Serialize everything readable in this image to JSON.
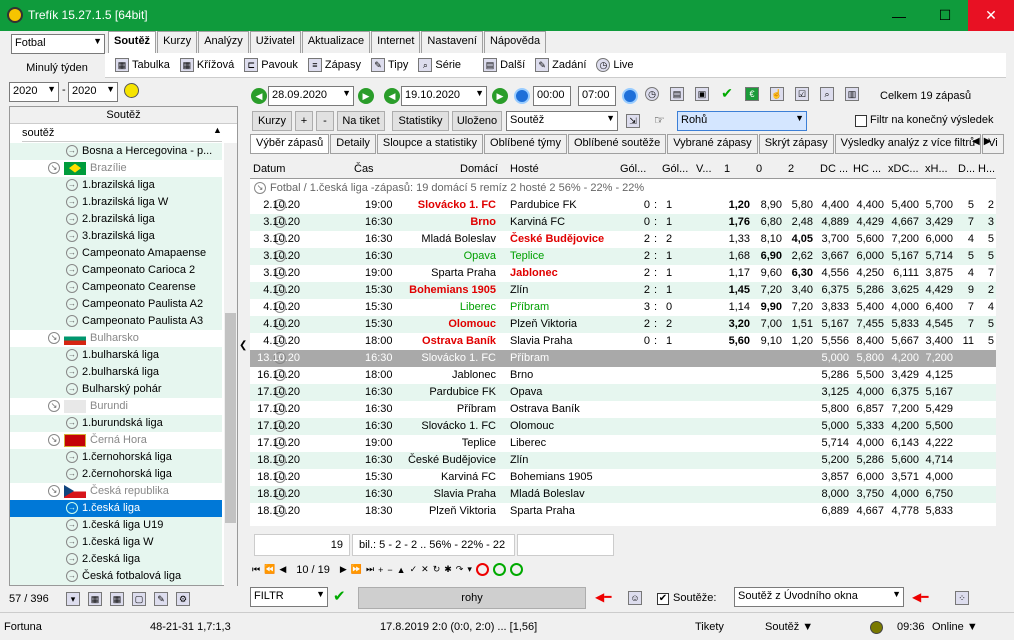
{
  "window": {
    "title": "Trefík 15.27.1.5 [64bit]",
    "min": "—",
    "max": "☐",
    "close": "✕"
  },
  "sport_select": "Fotbal",
  "period_label": "Minulý týden",
  "year_from": "2020",
  "year_to": "2020",
  "year_sep": "-",
  "menu": [
    "Soutěž",
    "Kurzy",
    "Analýzy",
    "Uživatel",
    "Aktualizace",
    "Internet",
    "Nastavení",
    "Nápověda"
  ],
  "toolbar": [
    "Tabulka",
    "Křížová",
    "Pavouk",
    "Zápasy",
    "Tipy",
    "Série",
    "Další",
    "Zadání",
    "Live"
  ],
  "left": {
    "header": "Soutěž",
    "filter": "soutěž",
    "count": "57 / 396",
    "rows": [
      {
        "t": "Bosna a Hercegovina - p...",
        "k": "lg"
      },
      {
        "t": "Brazílie",
        "k": "country",
        "flag": "br"
      },
      {
        "t": "1.brazilská liga",
        "k": "lg"
      },
      {
        "t": "1.brazilská liga W",
        "k": "lg"
      },
      {
        "t": "2.brazilská liga",
        "k": "lg"
      },
      {
        "t": "3.brazilská liga",
        "k": "lg"
      },
      {
        "t": "Campeonato Amapaense",
        "k": "lg"
      },
      {
        "t": "Campeonato Carioca 2",
        "k": "lg"
      },
      {
        "t": "Campeonato Cearense",
        "k": "lg"
      },
      {
        "t": "Campeonato Paulista A2",
        "k": "lg"
      },
      {
        "t": "Campeonato Paulista A3",
        "k": "lg"
      },
      {
        "t": "Bulharsko",
        "k": "country",
        "flag": "bg"
      },
      {
        "t": "1.bulharská liga",
        "k": "lg"
      },
      {
        "t": "2.bulharská liga",
        "k": "lg"
      },
      {
        "t": "Bulharský pohár",
        "k": "lg"
      },
      {
        "t": "Burundi",
        "k": "country",
        "flag": "bu"
      },
      {
        "t": "1.burundská liga",
        "k": "lg"
      },
      {
        "t": "Černá Hora",
        "k": "country",
        "flag": "me"
      },
      {
        "t": "1.černohorská liga",
        "k": "lg"
      },
      {
        "t": "2.černohorská liga",
        "k": "lg"
      },
      {
        "t": "Česká republika",
        "k": "country",
        "flag": "cz"
      },
      {
        "t": "1.česká liga",
        "k": "sel"
      },
      {
        "t": "1.česká liga U19",
        "k": "lg"
      },
      {
        "t": "1.česká liga W",
        "k": "lg"
      },
      {
        "t": "2.česká liga",
        "k": "lg"
      },
      {
        "t": "Česká fotbalová liga",
        "k": "lg"
      }
    ]
  },
  "date_from": "28.09.2020",
  "date_to": "19.10.2020",
  "time_from": "00:00",
  "time_to": "07:00",
  "total_label": "Celkem 19 zápasů",
  "buttons": {
    "kurzy": "Kurzy",
    "plus": "+",
    "minus": "-",
    "na_tiket": "Na tiket",
    "statistiky": "Statistiky",
    "ulozeno": "Uloženo"
  },
  "souteze_select": "Soutěž",
  "rohu_select": "Rohů",
  "filtr_label": "Filtr na konečný výsledek",
  "tabs2": [
    "Výběr zápasů",
    "Detaily",
    "Sloupce a statistiky",
    "Oblíbené týmy",
    "Oblíbené soutěže",
    "Vybrané zápasy",
    "Skrýt zápasy",
    "Výsledky analýz z více filtrů",
    "Vi"
  ],
  "cols": [
    "Datum",
    "Čas",
    "Domácí",
    "Hosté",
    "Gól...",
    "Gól...",
    "V...",
    "1",
    "0",
    "2",
    "DC ...",
    "HC ...",
    "xDC...",
    "xH...",
    "D...",
    "H..."
  ],
  "group": "Fotbal / 1.česká liga -zápasů: 19  domácí 5  remíz 2  hosté 2      56% - 22% - 22%",
  "rows": [
    {
      "d": "2.10.20",
      "t": "19:00",
      "h": "Slovácko 1. FC",
      "a": "Pardubice FK",
      "g1": "0",
      "g2": "1",
      "o1": "1,20",
      "o0": "8,90",
      "o2": "5,80",
      "dc": "4,400",
      "hc": "4,400",
      "xdc": "5,400",
      "xh": "5,700",
      "dd": "5",
      "hh": "2",
      "hs": "r",
      "as": "",
      "bo": "1"
    },
    {
      "d": "3.10.20",
      "t": "16:30",
      "h": "Brno",
      "a": "Karviná FC",
      "g1": "0",
      "g2": "1",
      "o1": "1,76",
      "o0": "6,80",
      "o2": "2,48",
      "dc": "4,889",
      "hc": "4,429",
      "xdc": "4,667",
      "xh": "3,429",
      "dd": "7",
      "hh": "3",
      "hs": "r",
      "as": "",
      "bo": "1"
    },
    {
      "d": "3.10.20",
      "t": "16:30",
      "h": "Mladá Boleslav",
      "a": "České Budějovice",
      "g1": "2",
      "g2": "2",
      "o1": "1,33",
      "o0": "8,10",
      "o2": "4,05",
      "dc": "3,700",
      "hc": "5,600",
      "xdc": "7,200",
      "xh": "6,000",
      "dd": "4",
      "hh": "5",
      "hs": "",
      "as": "r",
      "bo": "2"
    },
    {
      "d": "3.10.20",
      "t": "16:30",
      "h": "Opava",
      "a": "Teplice",
      "g1": "2",
      "g2": "1",
      "o1": "1,68",
      "o0": "6,90",
      "o2": "2,62",
      "dc": "3,667",
      "hc": "6,000",
      "xdc": "5,167",
      "xh": "5,714",
      "dd": "5",
      "hh": "5",
      "hs": "g",
      "as": "g",
      "bo": "0"
    },
    {
      "d": "3.10.20",
      "t": "19:00",
      "h": "Sparta Praha",
      "a": "Jablonec",
      "g1": "2",
      "g2": "1",
      "o1": "1,17",
      "o0": "9,60",
      "o2": "6,30",
      "dc": "4,556",
      "hc": "4,250",
      "xdc": "6,111",
      "xh": "3,875",
      "dd": "4",
      "hh": "7",
      "hs": "",
      "as": "r",
      "bo": "2"
    },
    {
      "d": "4.10.20",
      "t": "15:30",
      "h": "Bohemians 1905",
      "a": "Zlín",
      "g1": "2",
      "g2": "1",
      "o1": "1,45",
      "o0": "7,20",
      "o2": "3,40",
      "dc": "6,375",
      "hc": "5,286",
      "xdc": "3,625",
      "xh": "4,429",
      "dd": "9",
      "hh": "2",
      "hs": "r",
      "as": "",
      "bo": "1"
    },
    {
      "d": "4.10.20",
      "t": "15:30",
      "h": "Liberec",
      "a": "Příbram",
      "g1": "3",
      "g2": "0",
      "o1": "1,14",
      "o0": "9,90",
      "o2": "7,20",
      "dc": "3,833",
      "hc": "5,400",
      "xdc": "4,000",
      "xh": "6,400",
      "dd": "7",
      "hh": "4",
      "hs": "g",
      "as": "g",
      "bo": "0"
    },
    {
      "d": "4.10.20",
      "t": "15:30",
      "h": "Olomouc",
      "a": "Plzeň Viktoria",
      "g1": "2",
      "g2": "2",
      "o1": "3,20",
      "o0": "7,00",
      "o2": "1,51",
      "dc": "5,167",
      "hc": "7,455",
      "xdc": "5,833",
      "xh": "4,545",
      "dd": "7",
      "hh": "5",
      "hs": "r",
      "as": "",
      "bo": "1"
    },
    {
      "d": "4.10.20",
      "t": "18:00",
      "h": "Ostrava Baník",
      "a": "Slavia Praha",
      "g1": "0",
      "g2": "1",
      "o1": "5,60",
      "o0": "9,10",
      "o2": "1,20",
      "dc": "5,556",
      "hc": "8,400",
      "xdc": "5,667",
      "xh": "3,400",
      "dd": "11",
      "hh": "5",
      "hs": "r",
      "as": "",
      "bo": "1"
    },
    {
      "d": "13.10.20",
      "t": "16:30",
      "h": "Slovácko 1. FC",
      "a": "Příbram",
      "g1": "",
      "g2": "",
      "o1": "",
      "o0": "",
      "o2": "",
      "dc": "5,000",
      "hc": "5,800",
      "xdc": "4,200",
      "xh": "7,200",
      "dd": "",
      "hh": "",
      "hs": "",
      "as": "",
      "bo": "",
      "gray": true
    },
    {
      "d": "16.10.20",
      "t": "18:00",
      "h": "Jablonec",
      "a": "Brno",
      "g1": "",
      "g2": "",
      "o1": "",
      "o0": "",
      "o2": "",
      "dc": "5,286",
      "hc": "5,500",
      "xdc": "3,429",
      "xh": "4,125",
      "dd": "",
      "hh": "",
      "hs": "",
      "as": "",
      "bo": ""
    },
    {
      "d": "17.10.20",
      "t": "16:30",
      "h": "Pardubice FK",
      "a": "Opava",
      "g1": "",
      "g2": "",
      "o1": "",
      "o0": "",
      "o2": "",
      "dc": "3,125",
      "hc": "4,000",
      "xdc": "6,375",
      "xh": "5,167",
      "dd": "",
      "hh": "",
      "hs": "",
      "as": "",
      "bo": ""
    },
    {
      "d": "17.10.20",
      "t": "16:30",
      "h": "Příbram",
      "a": "Ostrava Baník",
      "g1": "",
      "g2": "",
      "o1": "",
      "o0": "",
      "o2": "",
      "dc": "5,800",
      "hc": "6,857",
      "xdc": "7,200",
      "xh": "5,429",
      "dd": "",
      "hh": "",
      "hs": "",
      "as": "",
      "bo": ""
    },
    {
      "d": "17.10.20",
      "t": "16:30",
      "h": "Slovácko 1. FC",
      "a": "Olomouc",
      "g1": "",
      "g2": "",
      "o1": "",
      "o0": "",
      "o2": "",
      "dc": "5,000",
      "hc": "5,333",
      "xdc": "4,200",
      "xh": "5,500",
      "dd": "",
      "hh": "",
      "hs": "",
      "as": "",
      "bo": ""
    },
    {
      "d": "17.10.20",
      "t": "19:00",
      "h": "Teplice",
      "a": "Liberec",
      "g1": "",
      "g2": "",
      "o1": "",
      "o0": "",
      "o2": "",
      "dc": "5,714",
      "hc": "4,000",
      "xdc": "6,143",
      "xh": "4,222",
      "dd": "",
      "hh": "",
      "hs": "",
      "as": "",
      "bo": ""
    },
    {
      "d": "18.10.20",
      "t": "16:30",
      "h": "České Budějovice",
      "a": "Zlín",
      "g1": "",
      "g2": "",
      "o1": "",
      "o0": "",
      "o2": "",
      "dc": "5,200",
      "hc": "5,286",
      "xdc": "5,600",
      "xh": "4,714",
      "dd": "",
      "hh": "",
      "hs": "",
      "as": "",
      "bo": ""
    },
    {
      "d": "18.10.20",
      "t": "15:30",
      "h": "Karviná FC",
      "a": "Bohemians 1905",
      "g1": "",
      "g2": "",
      "o1": "",
      "o0": "",
      "o2": "",
      "dc": "3,857",
      "hc": "6,000",
      "xdc": "3,571",
      "xh": "4,000",
      "dd": "",
      "hh": "",
      "hs": "",
      "as": "",
      "bo": ""
    },
    {
      "d": "18.10.20",
      "t": "16:30",
      "h": "Slavia Praha",
      "a": "Mladá Boleslav",
      "g1": "",
      "g2": "",
      "o1": "",
      "o0": "",
      "o2": "",
      "dc": "8,000",
      "hc": "3,750",
      "xdc": "4,000",
      "xh": "6,750",
      "dd": "",
      "hh": "",
      "hs": "",
      "as": "",
      "bo": ""
    },
    {
      "d": "18.10.20",
      "t": "18:30",
      "h": "Plzeň Viktoria",
      "a": "Sparta Praha",
      "g1": "",
      "g2": "",
      "o1": "",
      "o0": "",
      "o2": "",
      "dc": "6,889",
      "hc": "4,667",
      "xdc": "4,778",
      "xh": "5,833",
      "dd": "",
      "hh": "",
      "hs": "",
      "as": "",
      "bo": ""
    }
  ],
  "summary": {
    "count": "19",
    "text": "bil.: 5 - 2 - 2 ..  56% - 22% - 22"
  },
  "nav": {
    "pos": "10 / 19"
  },
  "bottom": {
    "filtr": "FILTR",
    "rohy": "rohy",
    "souteze_cb": "Soutěže:",
    "souteze_val": "Soutěž z Úvodního okna"
  },
  "status": {
    "s1": "Fortuna",
    "s2": "48-21-31  1,7:1,3",
    "s3": "17.8.2019 2:0 (0:0, 2:0) ... [1,56]",
    "s4": "Tikety",
    "s5": "Soutěž ▼",
    "s6": "09:36",
    "s7": "Online ▼"
  }
}
